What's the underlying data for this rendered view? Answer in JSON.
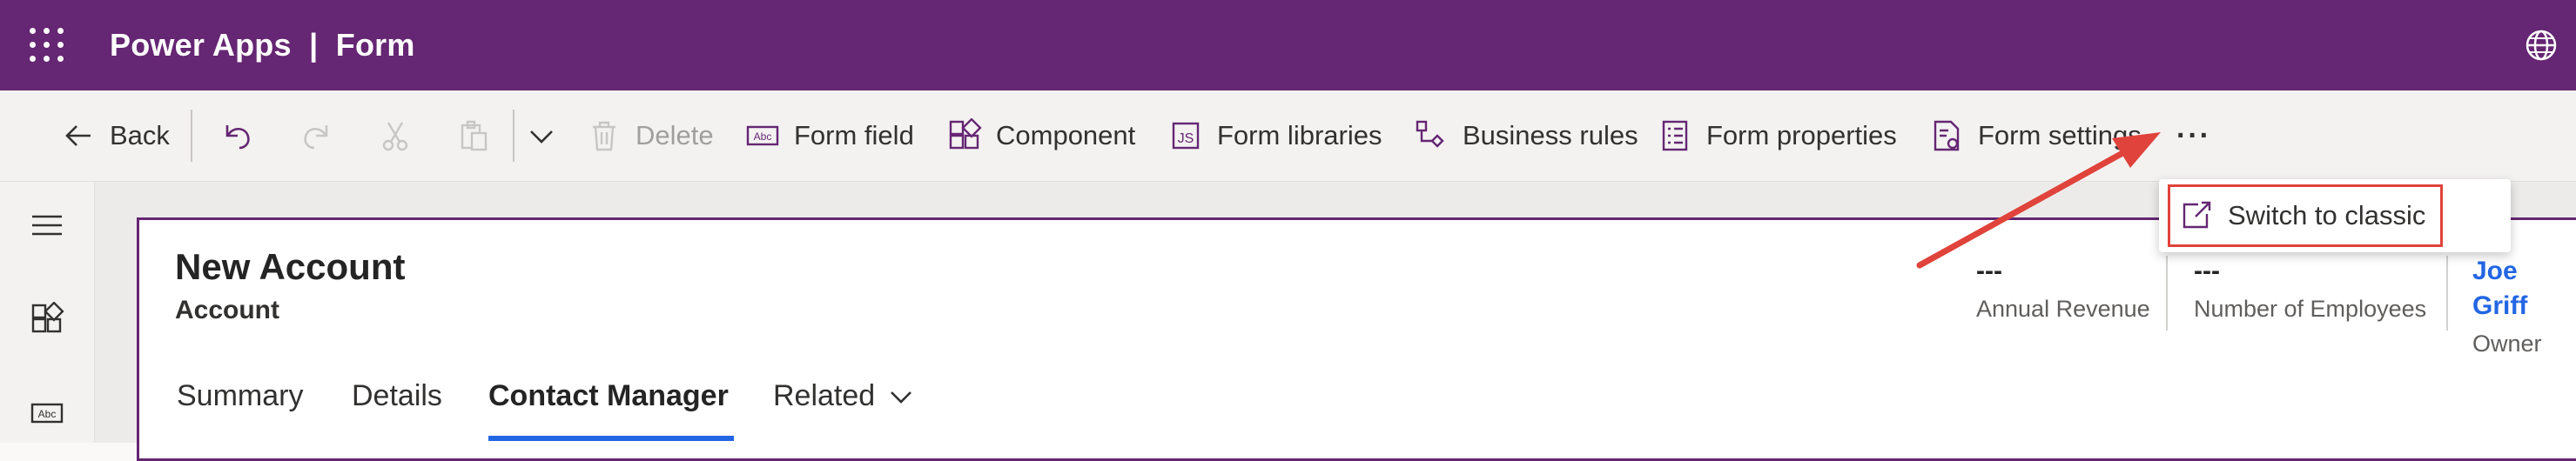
{
  "topbar": {
    "app_name": "Power Apps",
    "separator": "|",
    "page": "Form",
    "color": "#652673"
  },
  "commands": {
    "back": "Back",
    "delete": "Delete",
    "form_field": "Form field",
    "component": "Component",
    "form_libraries": "Form libraries",
    "business_rules": "Business rules",
    "form_properties": "Form properties",
    "form_settings": "Form settings",
    "more": "···"
  },
  "dropdown": {
    "switch_to_classic": "Switch to classic"
  },
  "form": {
    "title": "New Account",
    "entity": "Account",
    "header_fields": [
      {
        "value": "---",
        "label": "Annual Revenue"
      },
      {
        "value": "---",
        "label": "Number of Employees"
      },
      {
        "value": "Joe Griff",
        "label": "Owner"
      }
    ],
    "tabs": [
      "Summary",
      "Details",
      "Contact Manager",
      "Related"
    ],
    "active_tab": "Contact Manager"
  },
  "colors": {
    "accent_blue": "#2266e3",
    "annotation_red": "#e0433b",
    "link_blue": "#2266e3"
  },
  "icons": [
    "waffle-icon",
    "globe-icon",
    "back-arrow-icon",
    "undo-icon",
    "redo-icon",
    "cut-icon",
    "paste-icon",
    "chevron-down-icon",
    "delete-icon",
    "form-field-icon",
    "component-icon",
    "form-libraries-icon",
    "business-rules-icon",
    "form-properties-icon",
    "form-settings-icon",
    "more-icon",
    "external-link-icon",
    "hamburger-icon",
    "components-icon",
    "text-field-icon"
  ]
}
